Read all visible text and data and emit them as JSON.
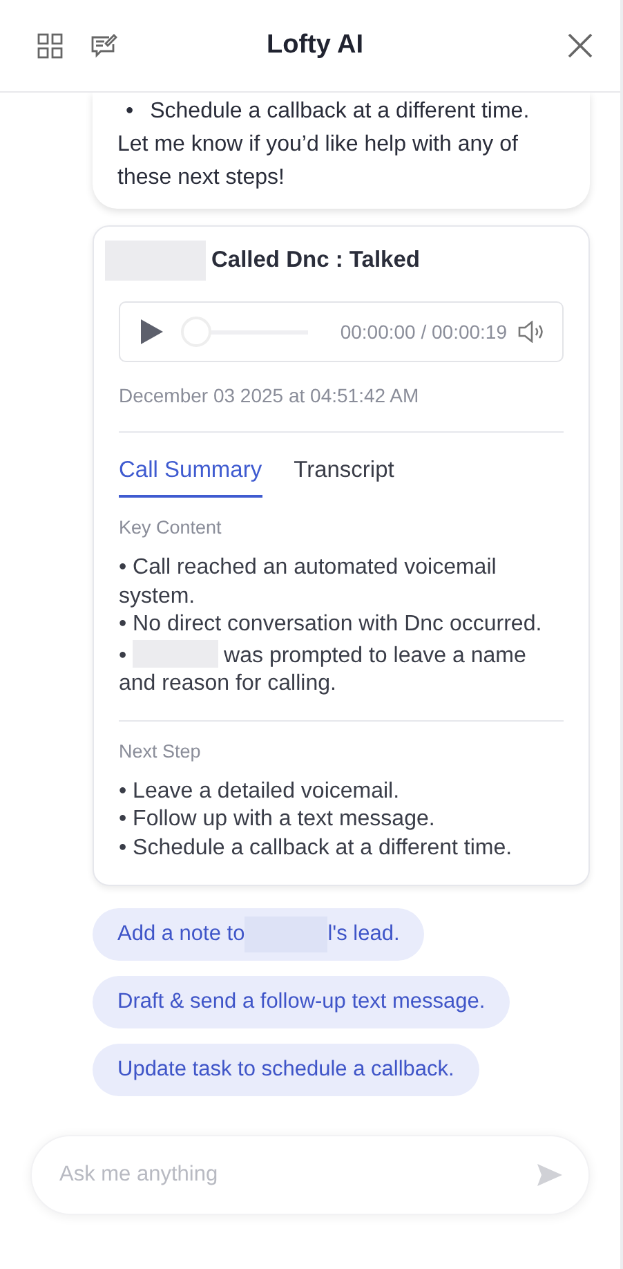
{
  "header": {
    "title": "Lofty AI"
  },
  "message": {
    "bullets": [
      {
        "bullet": "•",
        "text": "Schedule a callback at a different time."
      }
    ],
    "text": "Let me know if you’d like help with any of these next steps!"
  },
  "call_card": {
    "caller_redacted": true,
    "title": "Called Dnc : Talked",
    "player": {
      "level": 0,
      "time": "00:00:00 / 00:00:19"
    },
    "date": "December 03 2025 at 04:51:42 AM",
    "tabs": [
      {
        "label": "Call Summary",
        "selected": true
      },
      {
        "label": "Transcript",
        "selected": false
      }
    ],
    "sections": [
      {
        "heading": "Key Content",
        "items": [
          {
            "bullet": "•",
            "text": "Call reached an automated voicemail system.",
            "redacted": false
          },
          {
            "bullet": "•",
            "text": "No direct conversation with Dnc occurred.",
            "redacted": false
          },
          {
            "bullet": "•",
            "text": "was prompted to leave a name and reason for calling.",
            "redacted": true
          }
        ]
      },
      {
        "heading": "Next Step",
        "items": [
          {
            "bullet": "•",
            "text": "Leave a detailed voicemail.",
            "redacted": false
          },
          {
            "bullet": "•",
            "text": "Follow up with a text message.",
            "redacted": false
          },
          {
            "bullet": "•",
            "text": "Schedule a callback at a different time.",
            "redacted": false
          }
        ]
      }
    ]
  },
  "suggestions": [
    {
      "text": "Add a note to",
      "redacted": true,
      "suffix": "l's lead."
    },
    {
      "text": "Draft & send a follow-up text message.",
      "redacted": false
    },
    {
      "text": "Update task to schedule a callback.",
      "redacted": false
    }
  ],
  "input": {
    "placeholder": "Ask me anything"
  }
}
